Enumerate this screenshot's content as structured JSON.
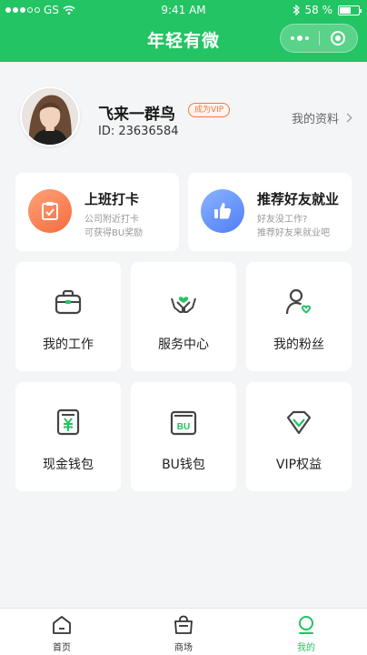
{
  "status_bar": {
    "carrier": "GS",
    "time": "9:41 AM",
    "battery": "58 %",
    "battery_level": 0.58
  },
  "nav": {
    "title": "年轻有微",
    "more_icon": "more-dots-icon",
    "close_icon": "target-icon"
  },
  "profile": {
    "name": "飞来一群鸟",
    "badge": "成为VIP",
    "id_text": "ID: 23636584",
    "link_label": "我的资料"
  },
  "features": [
    {
      "title": "上班打卡",
      "line1": "公司附近打卡",
      "line2": "可获得BU奖励",
      "icon": "clipboard-check-icon",
      "color": "#f56b3b"
    },
    {
      "title": "推荐好友就业",
      "line1": "好友没工作?",
      "line2": "推荐好友来就业吧",
      "icon": "thumbs-up-icon",
      "color": "#4f7ef7"
    }
  ],
  "grid": [
    {
      "label": "我的工作",
      "icon": "briefcase-icon"
    },
    {
      "label": "服务中心",
      "icon": "hands-heart-icon"
    },
    {
      "label": "我的粉丝",
      "icon": "user-heart-icon"
    },
    {
      "label": "现金钱包",
      "icon": "yuan-wallet-icon"
    },
    {
      "label": "BU钱包",
      "icon": "bu-wallet-icon"
    },
    {
      "label": "VIP权益",
      "icon": "vip-diamond-icon"
    }
  ],
  "tabbar": {
    "items": [
      {
        "label": "首页",
        "icon": "home-icon"
      },
      {
        "label": "商场",
        "icon": "shopping-bag-icon"
      },
      {
        "label": "我的",
        "icon": "profile-icon"
      }
    ],
    "active": "我的"
  },
  "colors": {
    "brand": "#22c463",
    "accent_orange": "#f0783c",
    "icon_green": "#22c463",
    "icon_gray": "#444444"
  }
}
